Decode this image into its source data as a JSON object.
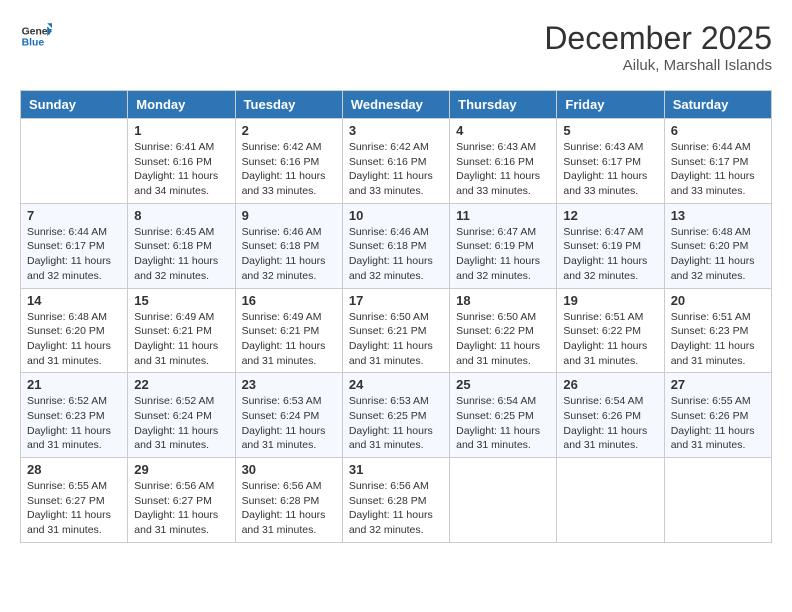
{
  "header": {
    "logo_general": "General",
    "logo_blue": "Blue",
    "month": "December 2025",
    "location": "Ailuk, Marshall Islands"
  },
  "weekdays": [
    "Sunday",
    "Monday",
    "Tuesday",
    "Wednesday",
    "Thursday",
    "Friday",
    "Saturday"
  ],
  "weeks": [
    [
      {
        "day": "",
        "sunrise": "",
        "sunset": "",
        "daylight": ""
      },
      {
        "day": "1",
        "sunrise": "Sunrise: 6:41 AM",
        "sunset": "Sunset: 6:16 PM",
        "daylight": "Daylight: 11 hours and 34 minutes."
      },
      {
        "day": "2",
        "sunrise": "Sunrise: 6:42 AM",
        "sunset": "Sunset: 6:16 PM",
        "daylight": "Daylight: 11 hours and 33 minutes."
      },
      {
        "day": "3",
        "sunrise": "Sunrise: 6:42 AM",
        "sunset": "Sunset: 6:16 PM",
        "daylight": "Daylight: 11 hours and 33 minutes."
      },
      {
        "day": "4",
        "sunrise": "Sunrise: 6:43 AM",
        "sunset": "Sunset: 6:16 PM",
        "daylight": "Daylight: 11 hours and 33 minutes."
      },
      {
        "day": "5",
        "sunrise": "Sunrise: 6:43 AM",
        "sunset": "Sunset: 6:17 PM",
        "daylight": "Daylight: 11 hours and 33 minutes."
      },
      {
        "day": "6",
        "sunrise": "Sunrise: 6:44 AM",
        "sunset": "Sunset: 6:17 PM",
        "daylight": "Daylight: 11 hours and 33 minutes."
      }
    ],
    [
      {
        "day": "7",
        "sunrise": "Sunrise: 6:44 AM",
        "sunset": "Sunset: 6:17 PM",
        "daylight": "Daylight: 11 hours and 32 minutes."
      },
      {
        "day": "8",
        "sunrise": "Sunrise: 6:45 AM",
        "sunset": "Sunset: 6:18 PM",
        "daylight": "Daylight: 11 hours and 32 minutes."
      },
      {
        "day": "9",
        "sunrise": "Sunrise: 6:46 AM",
        "sunset": "Sunset: 6:18 PM",
        "daylight": "Daylight: 11 hours and 32 minutes."
      },
      {
        "day": "10",
        "sunrise": "Sunrise: 6:46 AM",
        "sunset": "Sunset: 6:18 PM",
        "daylight": "Daylight: 11 hours and 32 minutes."
      },
      {
        "day": "11",
        "sunrise": "Sunrise: 6:47 AM",
        "sunset": "Sunset: 6:19 PM",
        "daylight": "Daylight: 11 hours and 32 minutes."
      },
      {
        "day": "12",
        "sunrise": "Sunrise: 6:47 AM",
        "sunset": "Sunset: 6:19 PM",
        "daylight": "Daylight: 11 hours and 32 minutes."
      },
      {
        "day": "13",
        "sunrise": "Sunrise: 6:48 AM",
        "sunset": "Sunset: 6:20 PM",
        "daylight": "Daylight: 11 hours and 32 minutes."
      }
    ],
    [
      {
        "day": "14",
        "sunrise": "Sunrise: 6:48 AM",
        "sunset": "Sunset: 6:20 PM",
        "daylight": "Daylight: 11 hours and 31 minutes."
      },
      {
        "day": "15",
        "sunrise": "Sunrise: 6:49 AM",
        "sunset": "Sunset: 6:21 PM",
        "daylight": "Daylight: 11 hours and 31 minutes."
      },
      {
        "day": "16",
        "sunrise": "Sunrise: 6:49 AM",
        "sunset": "Sunset: 6:21 PM",
        "daylight": "Daylight: 11 hours and 31 minutes."
      },
      {
        "day": "17",
        "sunrise": "Sunrise: 6:50 AM",
        "sunset": "Sunset: 6:21 PM",
        "daylight": "Daylight: 11 hours and 31 minutes."
      },
      {
        "day": "18",
        "sunrise": "Sunrise: 6:50 AM",
        "sunset": "Sunset: 6:22 PM",
        "daylight": "Daylight: 11 hours and 31 minutes."
      },
      {
        "day": "19",
        "sunrise": "Sunrise: 6:51 AM",
        "sunset": "Sunset: 6:22 PM",
        "daylight": "Daylight: 11 hours and 31 minutes."
      },
      {
        "day": "20",
        "sunrise": "Sunrise: 6:51 AM",
        "sunset": "Sunset: 6:23 PM",
        "daylight": "Daylight: 11 hours and 31 minutes."
      }
    ],
    [
      {
        "day": "21",
        "sunrise": "Sunrise: 6:52 AM",
        "sunset": "Sunset: 6:23 PM",
        "daylight": "Daylight: 11 hours and 31 minutes."
      },
      {
        "day": "22",
        "sunrise": "Sunrise: 6:52 AM",
        "sunset": "Sunset: 6:24 PM",
        "daylight": "Daylight: 11 hours and 31 minutes."
      },
      {
        "day": "23",
        "sunrise": "Sunrise: 6:53 AM",
        "sunset": "Sunset: 6:24 PM",
        "daylight": "Daylight: 11 hours and 31 minutes."
      },
      {
        "day": "24",
        "sunrise": "Sunrise: 6:53 AM",
        "sunset": "Sunset: 6:25 PM",
        "daylight": "Daylight: 11 hours and 31 minutes."
      },
      {
        "day": "25",
        "sunrise": "Sunrise: 6:54 AM",
        "sunset": "Sunset: 6:25 PM",
        "daylight": "Daylight: 11 hours and 31 minutes."
      },
      {
        "day": "26",
        "sunrise": "Sunrise: 6:54 AM",
        "sunset": "Sunset: 6:26 PM",
        "daylight": "Daylight: 11 hours and 31 minutes."
      },
      {
        "day": "27",
        "sunrise": "Sunrise: 6:55 AM",
        "sunset": "Sunset: 6:26 PM",
        "daylight": "Daylight: 11 hours and 31 minutes."
      }
    ],
    [
      {
        "day": "28",
        "sunrise": "Sunrise: 6:55 AM",
        "sunset": "Sunset: 6:27 PM",
        "daylight": "Daylight: 11 hours and 31 minutes."
      },
      {
        "day": "29",
        "sunrise": "Sunrise: 6:56 AM",
        "sunset": "Sunset: 6:27 PM",
        "daylight": "Daylight: 11 hours and 31 minutes."
      },
      {
        "day": "30",
        "sunrise": "Sunrise: 6:56 AM",
        "sunset": "Sunset: 6:28 PM",
        "daylight": "Daylight: 11 hours and 31 minutes."
      },
      {
        "day": "31",
        "sunrise": "Sunrise: 6:56 AM",
        "sunset": "Sunset: 6:28 PM",
        "daylight": "Daylight: 11 hours and 32 minutes."
      },
      {
        "day": "",
        "sunrise": "",
        "sunset": "",
        "daylight": ""
      },
      {
        "day": "",
        "sunrise": "",
        "sunset": "",
        "daylight": ""
      },
      {
        "day": "",
        "sunrise": "",
        "sunset": "",
        "daylight": ""
      }
    ]
  ]
}
